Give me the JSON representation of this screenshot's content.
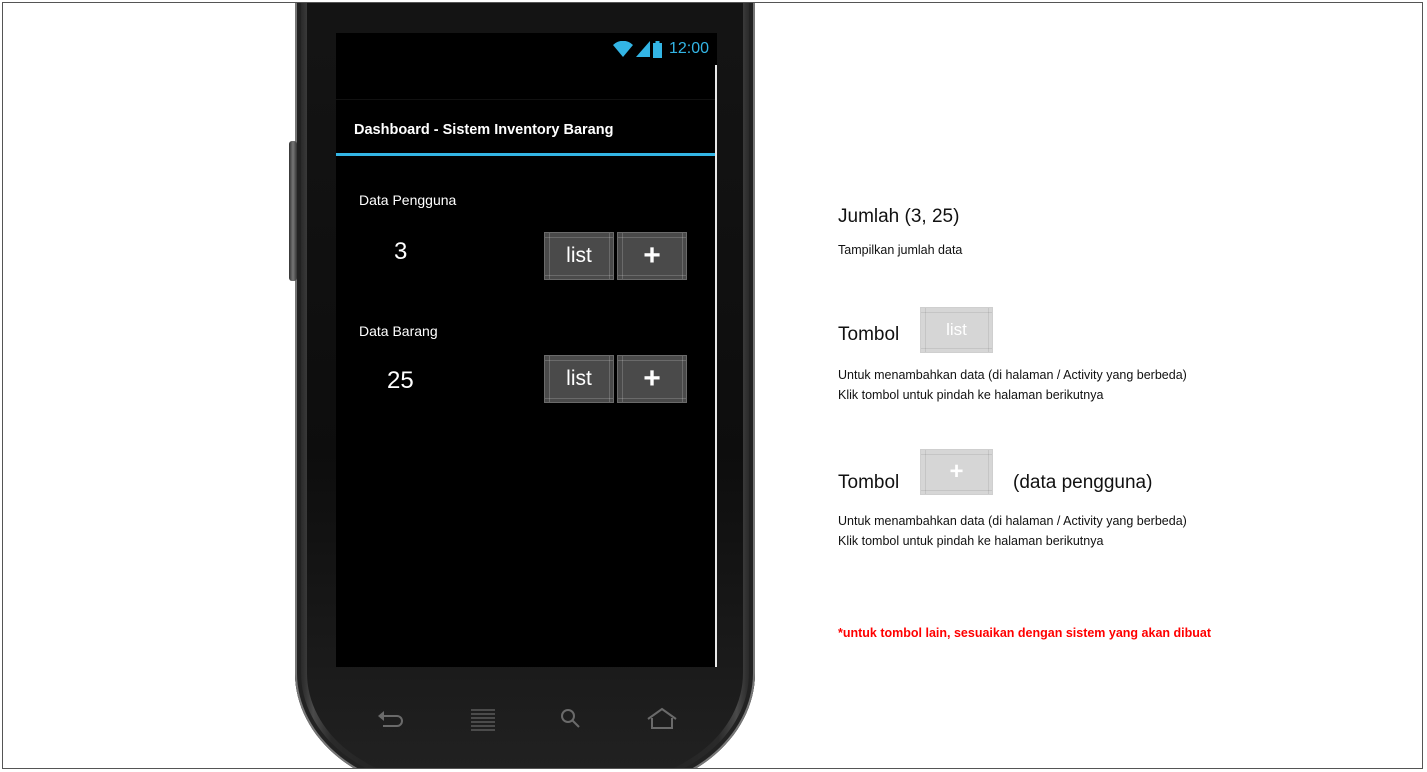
{
  "status_bar": {
    "time": "12:00",
    "accent_color": "#33b5e5",
    "icons": [
      "wifi-icon",
      "signal-icon",
      "battery-icon"
    ]
  },
  "action_bar": {
    "title": "Dashboard - Sistem Inventory Barang"
  },
  "sections": [
    {
      "label": "Data Pengguna",
      "count": "3",
      "list_label": "list",
      "add_label": "+"
    },
    {
      "label": "Data Barang",
      "count": "25",
      "list_label": "list",
      "add_label": "+"
    }
  ],
  "nav_keys": [
    "back-key-icon",
    "menu-key-icon",
    "search-key-icon",
    "home-key-icon"
  ],
  "annotations": {
    "count": {
      "heading": "Jumlah (3, 25)",
      "text": "Tampilkan jumlah data"
    },
    "list_button": {
      "heading": "Tombol",
      "sample_label": "list",
      "line1": "Untuk menambahkan data (di halaman / Activity yang berbeda)",
      "line2": "Klik tombol untuk pindah ke halaman berikutnya"
    },
    "add_button": {
      "heading": "Tombol",
      "sample_label": "+",
      "suffix": "(data pengguna)",
      "line1": "Untuk menambahkan data (di halaman / Activity yang berbeda)",
      "line2": "Klik tombol untuk pindah ke halaman berikutnya"
    },
    "note": "*untuk tombol lain, sesuaikan dengan sistem yang akan dibuat"
  }
}
